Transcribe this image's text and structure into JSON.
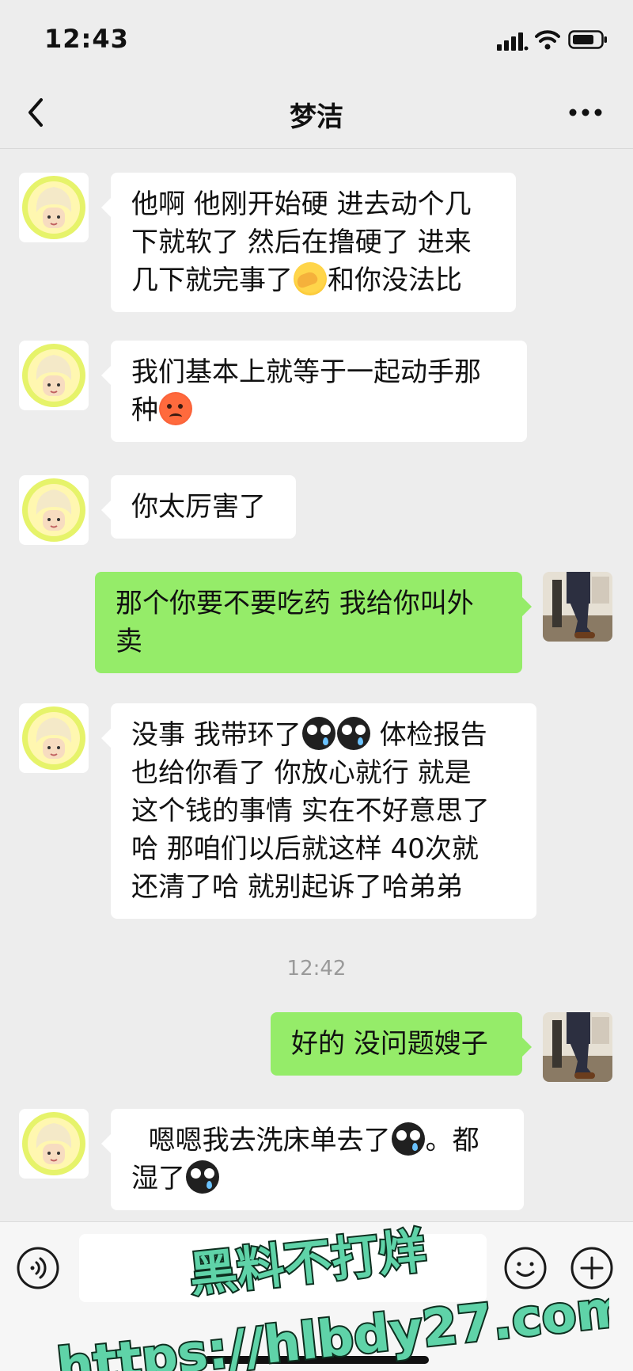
{
  "status_bar": {
    "time": "12:43",
    "icons": [
      "signal-icon",
      "wifi-icon",
      "battery-icon"
    ]
  },
  "nav": {
    "title": "梦洁",
    "back_icon": "chevron-left-icon",
    "more_icon": "more-dots-icon"
  },
  "messages": [
    {
      "side": "in",
      "segments": [
        {
          "text": "他啊 他刚开始硬 进去动个几\n下就软了 然后在撸硬了 进来\n几下就完事了"
        },
        {
          "emoji": "facepalm"
        },
        {
          "text": "和你没法比"
        }
      ]
    },
    {
      "side": "in",
      "segments": [
        {
          "text": "我们基本上就等于一起动手那\n种"
        },
        {
          "emoji": "hot-face"
        }
      ]
    },
    {
      "side": "in",
      "segments": [
        {
          "text": "你太厉害了"
        }
      ]
    },
    {
      "side": "out",
      "segments": [
        {
          "text": "那个你要不要吃药 我给你叫外\n卖"
        }
      ]
    },
    {
      "side": "in",
      "segments": [
        {
          "text": "没事 我带环了"
        },
        {
          "emoji": "crying-face"
        },
        {
          "emoji": "crying-face"
        },
        {
          "text": " 体检报告\n也给你看了 你放心就行 就是\n这个钱的事情 实在不好意思了\n哈 那咱们以后就这样 40次就\n还清了哈 就别起诉了哈弟弟"
        }
      ]
    },
    {
      "side": "out",
      "segments": [
        {
          "text": "好的 没问题嫂子"
        }
      ]
    },
    {
      "side": "in",
      "segments": [
        {
          "text": "  嗯嗯我去洗床单去了"
        },
        {
          "emoji": "crying-face"
        },
        {
          "text": "。都\n湿了"
        },
        {
          "emoji": "crying-face"
        }
      ]
    }
  ],
  "timestamp": "12:42",
  "input_bar": {
    "voice_icon": "voice-icon",
    "emoji_icon": "emoji-icon",
    "plus_icon": "plus-icon",
    "text_value": ""
  },
  "watermark": {
    "line1": "黑料不打烊",
    "line2": "https://hlbdy27.com"
  },
  "colors": {
    "background": "#ededed",
    "bubble_out": "#95ec69",
    "bubble_in": "#ffffff",
    "watermark_text": "#5fd3a8"
  }
}
